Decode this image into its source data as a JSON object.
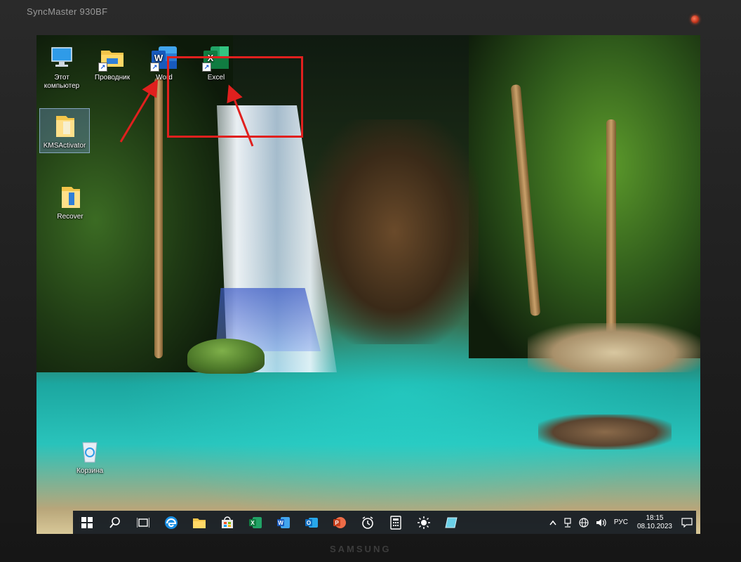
{
  "monitor": {
    "brand": "SyncMaster 930BF",
    "bottom_logo": "SAMSUNG"
  },
  "desktop": {
    "icons": [
      {
        "id": "this-pc",
        "label": "Этот компьютер"
      },
      {
        "id": "explorer",
        "label": "Проводник"
      },
      {
        "id": "word",
        "label": "Word"
      },
      {
        "id": "excel",
        "label": "Excel"
      },
      {
        "id": "kms",
        "label": "KMSActivator"
      },
      {
        "id": "recover",
        "label": "Recover"
      },
      {
        "id": "recycle",
        "label": "Корзина"
      }
    ],
    "annotation_color": "#e0201e"
  },
  "taskbar": {
    "pinned": [
      "start-icon",
      "search-icon",
      "task-view-icon",
      "edge-icon",
      "file-explorer-icon",
      "store-icon",
      "excel-icon",
      "word-icon",
      "outlook-icon",
      "powerpoint-icon",
      "alarm-clock-icon",
      "calculator-icon",
      "brightness-icon",
      "snip-icon"
    ],
    "tray": {
      "language": "РУС",
      "time": "18:15",
      "date": "08.10.2023"
    }
  },
  "colors": {
    "word": "#2b63c6",
    "excel": "#1e7a45",
    "taskbar": "#181e24"
  }
}
